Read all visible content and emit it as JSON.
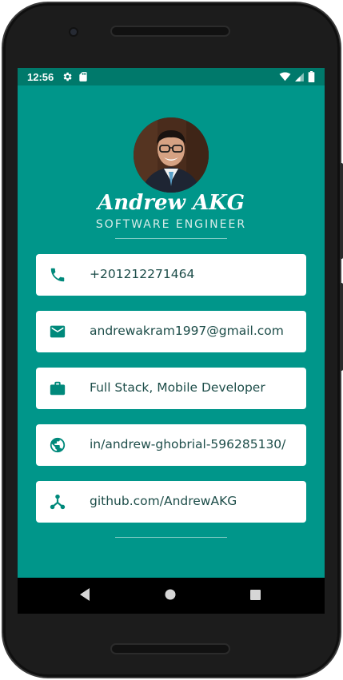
{
  "status_bar": {
    "time": "12:56",
    "left_icons": [
      "gear-icon",
      "sd-card-icon"
    ],
    "right_icons": [
      "wifi-icon",
      "signal-icon",
      "battery-icon"
    ]
  },
  "profile": {
    "name": "Andrew AKG",
    "title": "SOFTWARE ENGINEER",
    "avatar_icon": "avatar-photo"
  },
  "cards": [
    {
      "icon": "phone-icon",
      "text": "+201212271464"
    },
    {
      "icon": "email-icon",
      "text": "andrewakram1997@gmail.com"
    },
    {
      "icon": "briefcase-icon",
      "text": "Full Stack, Mobile Developer"
    },
    {
      "icon": "globe-icon",
      "text": "in/andrew-ghobrial-596285130/"
    },
    {
      "icon": "github-icon",
      "text": "github.com/AndrewAKG"
    }
  ],
  "colors": {
    "background": "#00968a",
    "status_bar": "#00796b",
    "accent": "#00897b",
    "card_text": "#1d4d49"
  },
  "nav_bar": [
    "back-icon",
    "home-icon",
    "recents-icon"
  ]
}
